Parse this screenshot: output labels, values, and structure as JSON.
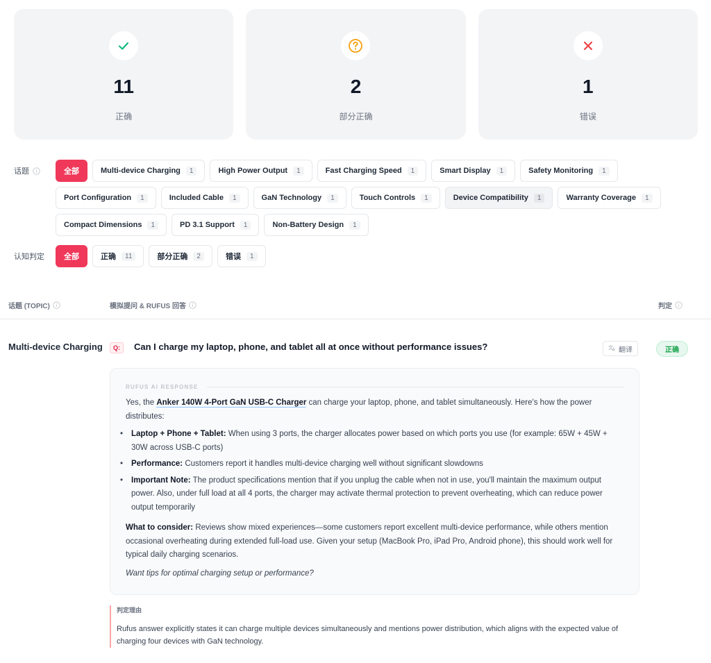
{
  "stats": [
    {
      "value": "11",
      "label": "正确",
      "icon": "check-icon",
      "color": "#10b981"
    },
    {
      "value": "2",
      "label": "部分正确",
      "icon": "question-circle-icon",
      "color": "#f59e0b"
    },
    {
      "value": "1",
      "label": "错误",
      "icon": "x-icon",
      "color": "#ef4444"
    }
  ],
  "filters": {
    "topic_label": "话题",
    "topics": [
      {
        "label": "全部",
        "count": ""
      },
      {
        "label": "Multi-device Charging",
        "count": "1"
      },
      {
        "label": "High Power Output",
        "count": "1"
      },
      {
        "label": "Fast Charging Speed",
        "count": "1"
      },
      {
        "label": "Smart Display",
        "count": "1"
      },
      {
        "label": "Safety Monitoring",
        "count": "1"
      },
      {
        "label": "Port Configuration",
        "count": "1"
      },
      {
        "label": "Included Cable",
        "count": "1"
      },
      {
        "label": "GaN Technology",
        "count": "1"
      },
      {
        "label": "Touch Controls",
        "count": "1"
      },
      {
        "label": "Device Compatibility",
        "count": "1"
      },
      {
        "label": "Warranty Coverage",
        "count": "1"
      },
      {
        "label": "Compact Dimensions",
        "count": "1"
      },
      {
        "label": "PD 3.1 Support",
        "count": "1"
      },
      {
        "label": "Non-Battery Design",
        "count": "1"
      }
    ],
    "verdict_label": "认知判定",
    "verdicts": [
      {
        "label": "全部",
        "count": ""
      },
      {
        "label": "正确",
        "count": "11"
      },
      {
        "label": "部分正确",
        "count": "2"
      },
      {
        "label": "错误",
        "count": "1"
      }
    ]
  },
  "table": {
    "col_topic": "话题 (TOPIC)",
    "col_qa": "模拟提问 & RUFUS 回答",
    "col_verdict": "判定"
  },
  "row": {
    "topic": "Multi-device Charging",
    "q_badge": "Q:",
    "question": "Can I charge my laptop, phone, and tablet all at once without performance issues?",
    "translate_label": "翻译",
    "verdict": "正确",
    "response_header": "RUFUS AI RESPONSE",
    "intro_pre": "Yes, the ",
    "product": "Anker 140W 4-Port GaN USB-C Charger",
    "intro_post": " can charge your laptop, phone, and tablet simultaneously. Here's how the power distributes:",
    "bullets": [
      {
        "title": "Laptop + Phone + Tablet:",
        "text": " When using 3 ports, the charger allocates power based on which ports you use (for example: 65W + 45W + 30W across USB-C ports)"
      },
      {
        "title": "Performance:",
        "text": " Customers report it handles multi-device charging well without significant slowdowns"
      },
      {
        "title": "Important Note:",
        "text": " The product specifications mention that if you unplug the cable when not in use, you'll maintain the maximum output power. Also, under full load at all 4 ports, the charger may activate thermal protection to prevent overheating, which can reduce power output temporarily"
      }
    ],
    "consider_title": "What to consider:",
    "consider_text": " Reviews show mixed experiences—some customers report excellent multi-device performance, while others mention occasional overheating during extended full-load use. Given your setup (MacBook Pro, iPad Pro, Android phone), this should work well for typical daily charging scenarios.",
    "closing_question": "Want tips for optimal charging setup or performance?",
    "reason_title": "判定理由",
    "reason_text": "Rufus answer explicitly states it can charge multiple devices simultaneously and mentions power distribution, which aligns with the expected value of charging four devices with GaN technology."
  }
}
